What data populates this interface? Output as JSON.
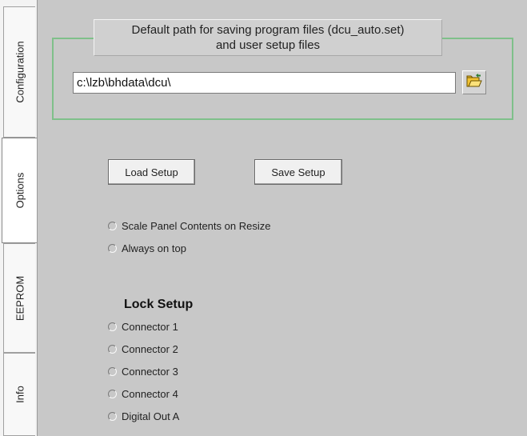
{
  "tabs": [
    {
      "label": "Configuration"
    },
    {
      "label": "Options",
      "active": true
    },
    {
      "label": "EEPROM"
    },
    {
      "label": "Info"
    }
  ],
  "path_group": {
    "title_line1": "Default path for saving program files (dcu_auto.set)",
    "title_line2": "and user setup files",
    "path_value": "c:\\lzb\\bhdata\\dcu\\"
  },
  "buttons": {
    "load_setup": "Load Setup",
    "save_setup": "Save Setup"
  },
  "options": {
    "scale_panel": "Scale Panel Contents on Resize",
    "always_on_top": "Always on top"
  },
  "lock_setup": {
    "title": "Lock Setup",
    "items": [
      "Connector 1",
      "Connector 2",
      "Connector 3",
      "Connector 4",
      "Digital Out A"
    ]
  },
  "colors": {
    "group_border": "#7fc08a",
    "panel_bg": "#c8c8c8"
  }
}
